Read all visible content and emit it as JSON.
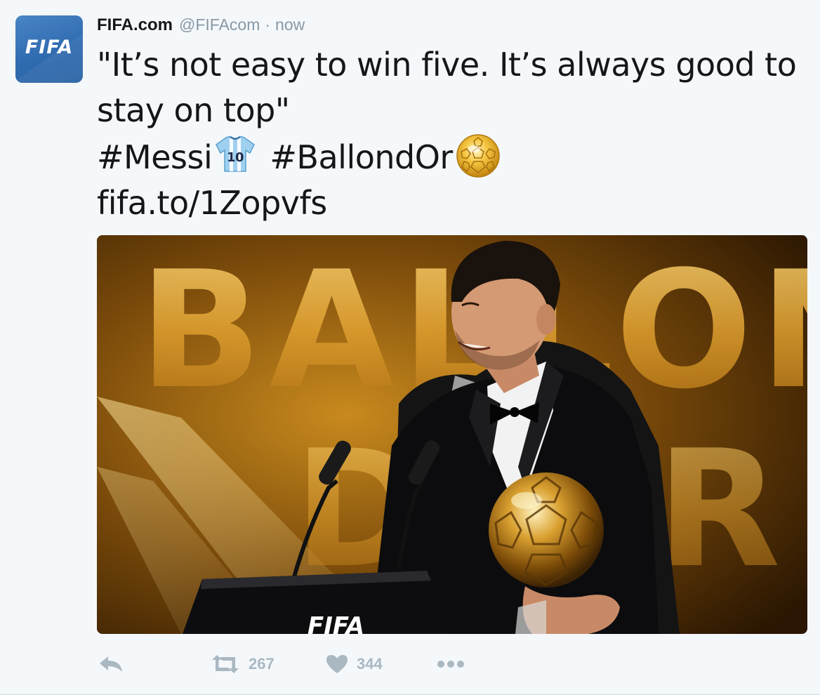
{
  "author": {
    "name": "FIFA.com",
    "handle": "@FIFAcom",
    "separator": "·",
    "time": "now",
    "avatar_text": "FIFA"
  },
  "tweet": {
    "line1": "\"It’s not easy to win five. It’s always good to",
    "line2": "stay on top\"",
    "hashtag1": "#Messi",
    "hashtag2": "#BallondOr",
    "link": "fifa.to/1Zopvfs"
  },
  "media": {
    "backdrop_text_top": "BALLON",
    "backdrop_text_bottom": "D'OR",
    "podium_text": "FIFA"
  },
  "actions": {
    "retweet_count": "267",
    "like_count": "344"
  },
  "icons": {
    "reply": "reply-arrow-icon",
    "retweet": "retweet-icon",
    "like": "heart-icon",
    "more": "more-dots-icon",
    "shirt": "argentina-jersey-10-emoji",
    "ball": "golden-ball-emoji"
  },
  "colors": {
    "background": "#f5f8fa",
    "text": "#14171a",
    "muted": "#8899a6",
    "action_icon": "#aab8c2",
    "avatar_blue": "#2f6bb0"
  }
}
